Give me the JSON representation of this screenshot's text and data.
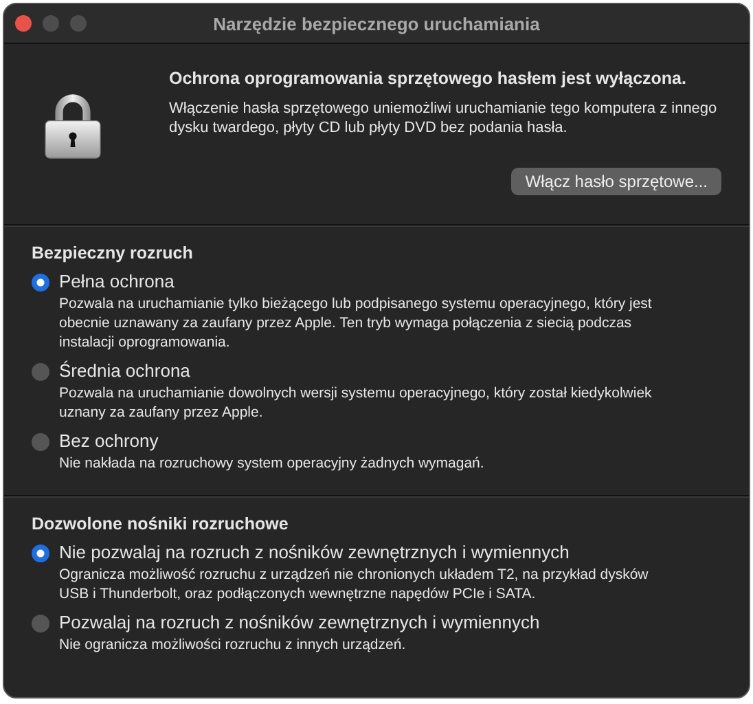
{
  "window": {
    "title": "Narzędzie bezpiecznego uruchamiania"
  },
  "firmware": {
    "heading": "Ochrona oprogramowania sprzętowego hasłem jest wyłączona.",
    "message": "Włączenie hasła sprzętowego uniemożliwi uruchamianie tego komputera z innego dysku twardego, płyty CD lub płyty DVD bez podania hasła.",
    "button": "Włącz hasło sprzętowe..."
  },
  "sections": [
    {
      "heading": "Bezpieczny rozruch",
      "options": [
        {
          "label": "Pełna ochrona",
          "description": "Pozwala na uruchamianie tylko bieżącego lub podpisanego systemu operacyjnego, który jest obecnie uznawany za zaufany przez Apple. Ten tryb wymaga połączenia z siecią podczas instalacji oprogramowania.",
          "selected": true
        },
        {
          "label": "Średnia ochrona",
          "description": "Pozwala na uruchamianie dowolnych wersji systemu operacyjnego, który został kiedykolwiek uznany za zaufany przez Apple.",
          "selected": false
        },
        {
          "label": "Bez ochrony",
          "description": "Nie nakłada na rozruchowy system operacyjny żadnych wymagań.",
          "selected": false
        }
      ]
    },
    {
      "heading": "Dozwolone nośniki rozruchowe",
      "options": [
        {
          "label": "Nie pozwalaj na rozruch z nośników zewnętrznych i wymiennych",
          "description": "Ogranicza możliwość rozruchu z urządzeń nie chronionych układem T2, na przykład dysków USB i Thunderbolt, oraz podłączonych wewnętrzne napędów PCIe i SATA.",
          "selected": true
        },
        {
          "label": "Pozwalaj na rozruch z nośników zewnętrznych i wymiennych",
          "description": "Nie ogranicza możliwości rozruchu z innych urządzeń.",
          "selected": false
        }
      ]
    }
  ]
}
